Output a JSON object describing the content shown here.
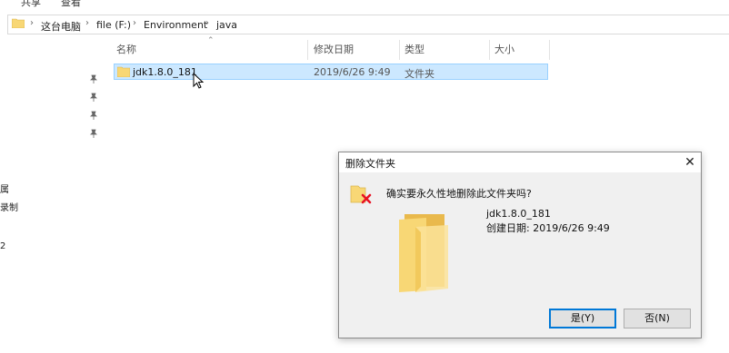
{
  "ribbon": {
    "tab_share": "共享",
    "tab_view": "查看"
  },
  "address": {
    "crumbs": [
      "这台电脑",
      "file (F:)",
      "Environment",
      "java"
    ],
    "separator": "›"
  },
  "nav": {
    "partial_items": [
      "属",
      "录制",
      "2"
    ]
  },
  "columns": {
    "name": "名称",
    "modified": "修改日期",
    "type": "类型",
    "size": "大小"
  },
  "file_row": {
    "name": "jdk1.8.0_181",
    "modified": "2019/6/26 9:49",
    "type": "文件夹",
    "size": ""
  },
  "dialog": {
    "title": "删除文件夹",
    "message": "确实要永久性地删除此文件夹吗?",
    "item_name": "jdk1.8.0_181",
    "item_date": "创建日期: 2019/6/26 9:49",
    "yes_label": "是(Y)",
    "no_label": "否(N)",
    "close_glyph": "✕"
  },
  "colors": {
    "selection_bg": "#cce8ff",
    "selection_border": "#99d1ff",
    "folder_yellow": "#f8d775",
    "accent": "#0078d7",
    "delete_red": "#e81123"
  }
}
